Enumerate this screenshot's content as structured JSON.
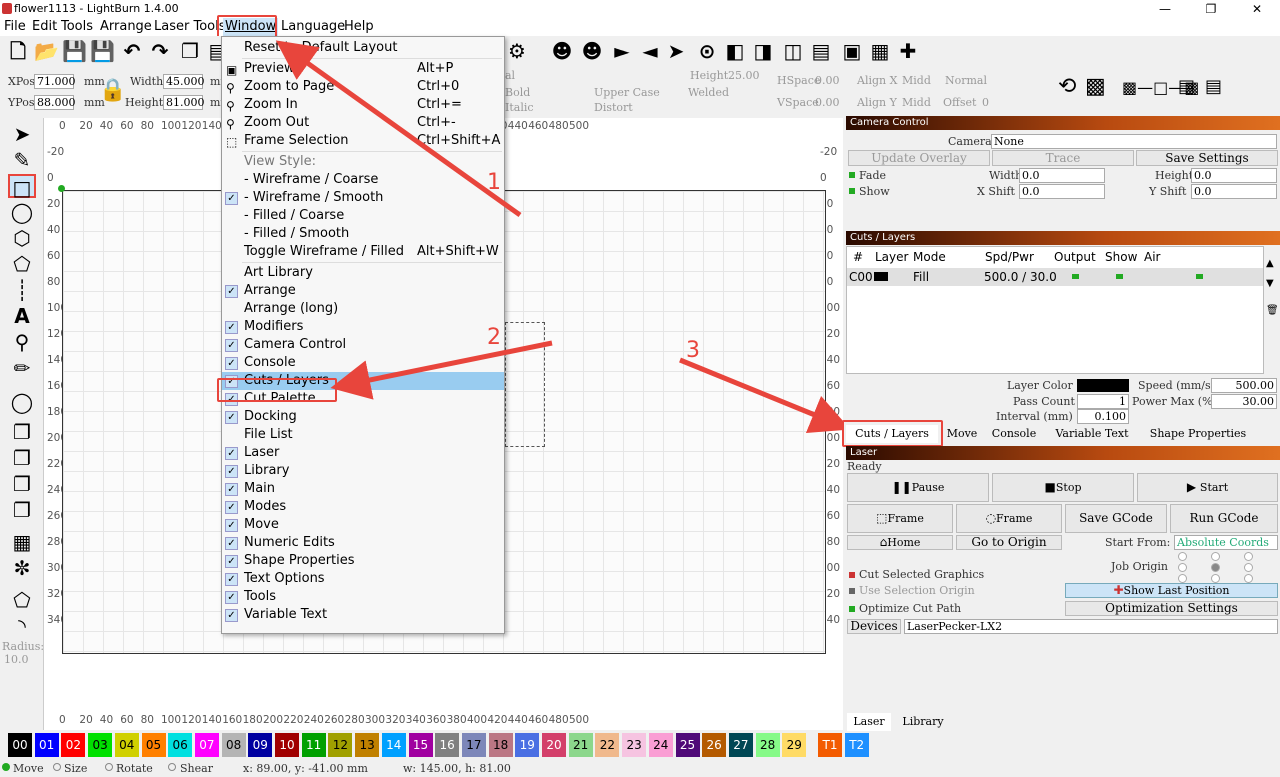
{
  "title": "flower1113 - LightBurn 1.4.00",
  "menus": [
    "File",
    "Edit",
    "Tools",
    "Arrange",
    "Laser Tools",
    "Window",
    "Language",
    "Help"
  ],
  "numeric": {
    "xpos_label": "XPos",
    "xpos": "71.000",
    "ypos_label": "YPos",
    "ypos": "88.000",
    "unit": "mm",
    "width_label": "Width",
    "width": "45.000",
    "height_label": "Height",
    "height": "81.000",
    "text_height_label": "Height",
    "text_height": "25.00",
    "hspace_label": "HSpace",
    "hspace": "0.00",
    "vspace_label": "VSpace",
    "vspace": "0.00",
    "alignx_label": "Align X",
    "alignx": "Midd",
    "aligny_label": "Align Y",
    "aligny": "Midd",
    "normal": "Normal",
    "offset_label": "Offset",
    "offset": "0",
    "bold": "Bold",
    "italic": "Italic",
    "upper": "Upper Case",
    "welded": "Welded",
    "distort": "Distort",
    "font_tail": "al"
  },
  "dropdown": [
    {
      "label": "Reset to Default Layout",
      "short": "",
      "check": false,
      "icon": ""
    },
    {
      "sep": true
    },
    {
      "label": "Preview",
      "short": "Alt+P",
      "check": false,
      "icon": "preview"
    },
    {
      "label": "Zoom to Page",
      "short": "Ctrl+0",
      "check": false,
      "icon": "zoom"
    },
    {
      "label": "Zoom In",
      "short": "Ctrl+=",
      "check": false,
      "icon": "zoom"
    },
    {
      "label": "Zoom Out",
      "short": "Ctrl+-",
      "check": false,
      "icon": "zoom"
    },
    {
      "label": "Frame Selection",
      "short": "Ctrl+Shift+A",
      "check": false,
      "icon": "frame"
    },
    {
      "sep": true
    },
    {
      "label": "View Style:",
      "short": "",
      "check": false,
      "icon": "",
      "dim": true
    },
    {
      "label": "-  Wireframe / Coarse",
      "short": "",
      "check": false,
      "icon": ""
    },
    {
      "label": "-  Wireframe / Smooth",
      "short": "",
      "check": true,
      "icon": ""
    },
    {
      "label": "-  Filled / Coarse",
      "short": "",
      "check": false,
      "icon": ""
    },
    {
      "label": "-  Filled / Smooth",
      "short": "",
      "check": false,
      "icon": ""
    },
    {
      "label": "Toggle Wireframe / Filled",
      "short": "Alt+Shift+W",
      "check": false,
      "icon": ""
    },
    {
      "sep": true
    },
    {
      "label": "Art Library",
      "short": "",
      "check": false,
      "icon": ""
    },
    {
      "label": "Arrange",
      "short": "",
      "check": true,
      "icon": ""
    },
    {
      "label": "Arrange (long)",
      "short": "",
      "check": false,
      "icon": ""
    },
    {
      "label": "Modifiers",
      "short": "",
      "check": true,
      "icon": ""
    },
    {
      "label": "Camera Control",
      "short": "",
      "check": true,
      "icon": ""
    },
    {
      "label": "Console",
      "short": "",
      "check": true,
      "icon": ""
    },
    {
      "label": "Cuts / Layers",
      "short": "",
      "check": true,
      "icon": "",
      "hl": true
    },
    {
      "label": "Cut Palette",
      "short": "",
      "check": true,
      "icon": ""
    },
    {
      "label": "Docking",
      "short": "",
      "check": true,
      "icon": ""
    },
    {
      "label": "File List",
      "short": "",
      "check": false,
      "icon": ""
    },
    {
      "label": "Laser",
      "short": "",
      "check": true,
      "icon": ""
    },
    {
      "label": "Library",
      "short": "",
      "check": true,
      "icon": ""
    },
    {
      "label": "Main",
      "short": "",
      "check": true,
      "icon": ""
    },
    {
      "label": "Modes",
      "short": "",
      "check": true,
      "icon": ""
    },
    {
      "label": "Move",
      "short": "",
      "check": true,
      "icon": ""
    },
    {
      "label": "Numeric Edits",
      "short": "",
      "check": true,
      "icon": ""
    },
    {
      "label": "Shape Properties",
      "short": "",
      "check": true,
      "icon": ""
    },
    {
      "label": "Text Options",
      "short": "",
      "check": true,
      "icon": ""
    },
    {
      "label": "Tools",
      "short": "",
      "check": true,
      "icon": ""
    },
    {
      "label": "Variable Text",
      "short": "",
      "check": true,
      "icon": ""
    }
  ],
  "ruler_top": [
    "0",
    "20",
    "40",
    "60",
    "80",
    "100",
    "120",
    "140",
    "160",
    "180",
    "200",
    "220",
    "240",
    "260",
    "280",
    "300",
    "320",
    "340",
    "360",
    "380",
    "400",
    "420",
    "440",
    "460",
    "480",
    "500"
  ],
  "ruler_left": [
    "-20",
    "0",
    "20",
    "40",
    "60",
    "80",
    "100",
    "120",
    "140",
    "160",
    "180",
    "200",
    "220",
    "240",
    "260",
    "280",
    "300",
    "320",
    "340"
  ],
  "radius_label": "Radius:",
  "radius": "10.0",
  "camera": {
    "title": "Camera Control",
    "camera_label": "Camera:",
    "camera": "None",
    "update": "Update Overlay",
    "trace": "Trace",
    "save": "Save Settings",
    "fade": "Fade",
    "show": "Show",
    "width_label": "Width",
    "width": "0.0",
    "xshift_label": "X Shift",
    "xshift": "0.0",
    "height_label": "Height",
    "height": "0.0",
    "yshift_label": "Y Shift",
    "yshift": "0.0"
  },
  "cuts": {
    "title": "Cuts / Layers",
    "headers": [
      "#",
      "Layer",
      "Mode",
      "Spd/Pwr",
      "Output",
      "Show",
      "Air"
    ],
    "row": {
      "num": "C00",
      "mode": "Fill",
      "spdpwr": "500.0 / 30.0"
    },
    "layer_color": "Layer Color",
    "speed_label": "Speed (mm/s)",
    "speed": "500.00",
    "pass_label": "Pass Count",
    "pass": "1",
    "power_label": "Power Max (%)",
    "power": "30.00",
    "interval_label": "Interval (mm)",
    "interval": "0.100"
  },
  "tabs": [
    "Cuts / Layers",
    "Move",
    "Console",
    "Variable Text",
    "Shape Properties"
  ],
  "laser": {
    "title": "Laser",
    "status": "Ready",
    "pause": "Pause",
    "stop": "Stop",
    "start": "Start",
    "frame1": "Frame",
    "frame2": "Frame",
    "save_gcode": "Save GCode",
    "run_gcode": "Run GCode",
    "home": "Home",
    "go_origin": "Go to Origin",
    "start_from_label": "Start From:",
    "start_from": "Absolute Coords",
    "job_origin": "Job Origin",
    "cut_selected": "Cut Selected Graphics",
    "use_selection": "Use Selection Origin",
    "optimize": "Optimize Cut Path",
    "show_last": "Show Last Position",
    "opt_settings": "Optimization Settings",
    "devices": "Devices",
    "device": "LaserPecker-LX2"
  },
  "bottom_tabs": [
    "Laser",
    "Library"
  ],
  "palette": [
    {
      "l": "00",
      "c": "#000000",
      "t": "#ffffff"
    },
    {
      "l": "01",
      "c": "#0000ff",
      "t": "#ffffff"
    },
    {
      "l": "02",
      "c": "#ff0000",
      "t": "#ffffff"
    },
    {
      "l": "03",
      "c": "#00e000",
      "t": "#000000"
    },
    {
      "l": "04",
      "c": "#d0d000",
      "t": "#000000"
    },
    {
      "l": "05",
      "c": "#ff8000",
      "t": "#000000"
    },
    {
      "l": "06",
      "c": "#00e0e0",
      "t": "#000000"
    },
    {
      "l": "07",
      "c": "#ff00ff",
      "t": "#ffffff"
    },
    {
      "l": "08",
      "c": "#b4b4b4",
      "t": "#000000"
    },
    {
      "l": "09",
      "c": "#0000a0",
      "t": "#ffffff"
    },
    {
      "l": "10",
      "c": "#a00000",
      "t": "#ffffff"
    },
    {
      "l": "11",
      "c": "#00a000",
      "t": "#ffffff"
    },
    {
      "l": "12",
      "c": "#a0a000",
      "t": "#000000"
    },
    {
      "l": "13",
      "c": "#c08000",
      "t": "#000000"
    },
    {
      "l": "14",
      "c": "#00a0ff",
      "t": "#ffffff"
    },
    {
      "l": "15",
      "c": "#a000a0",
      "t": "#ffffff"
    },
    {
      "l": "16",
      "c": "#808080",
      "t": "#ffffff"
    },
    {
      "l": "17",
      "c": "#7d87b9",
      "t": "#000000"
    },
    {
      "l": "18",
      "c": "#bb7784",
      "t": "#000000"
    },
    {
      "l": "19",
      "c": "#4a6fe3",
      "t": "#ffffff"
    },
    {
      "l": "20",
      "c": "#d33f6a",
      "t": "#ffffff"
    },
    {
      "l": "21",
      "c": "#8cd78c",
      "t": "#000000"
    },
    {
      "l": "22",
      "c": "#f0b98d",
      "t": "#000000"
    },
    {
      "l": "23",
      "c": "#f6c4e1",
      "t": "#000000"
    },
    {
      "l": "24",
      "c": "#fa9ed4",
      "t": "#000000"
    },
    {
      "l": "25",
      "c": "#500a78",
      "t": "#ffffff"
    },
    {
      "l": "26",
      "c": "#b45a00",
      "t": "#ffffff"
    },
    {
      "l": "27",
      "c": "#004754",
      "t": "#ffffff"
    },
    {
      "l": "28",
      "c": "#86fa88",
      "t": "#000000"
    },
    {
      "l": "29",
      "c": "#ffdb66",
      "t": "#000000"
    },
    {
      "l": "T1",
      "c": "#f35b00",
      "t": "#ffffff"
    },
    {
      "l": "T2",
      "c": "#1e90ff",
      "t": "#ffffff"
    }
  ],
  "status": {
    "move": "Move",
    "size": "Size",
    "rotate": "Rotate",
    "shear": "Shear",
    "coords": "x: 89.00, y: -41.00 mm",
    "wh": "w: 145.00,  h: 81.00"
  },
  "annotations": [
    "1",
    "2",
    "3"
  ],
  "accent": "#e8453c"
}
